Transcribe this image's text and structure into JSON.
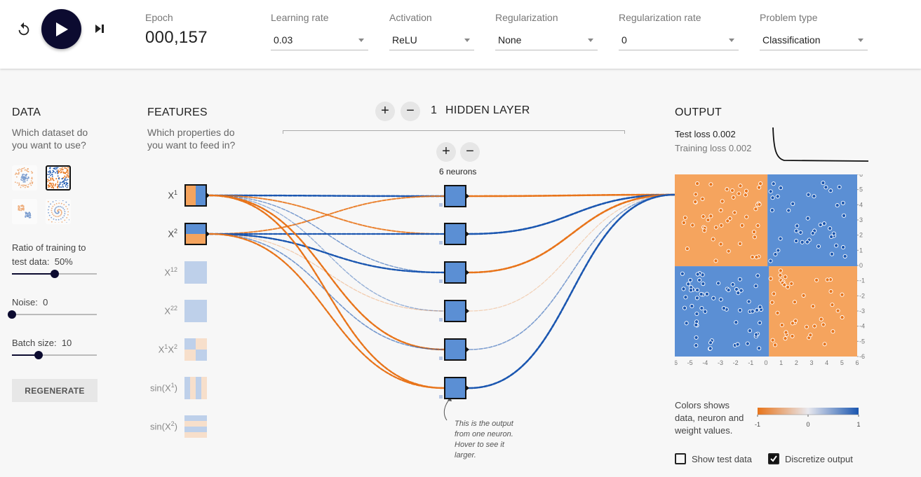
{
  "topbar": {
    "epoch_label": "Epoch",
    "epoch_value": "000,157",
    "learning_rate": {
      "label": "Learning rate",
      "value": "0.03"
    },
    "activation": {
      "label": "Activation",
      "value": "ReLU"
    },
    "regularization": {
      "label": "Regularization",
      "value": "None"
    },
    "regularization_rate": {
      "label": "Regularization rate",
      "value": "0"
    },
    "problem_type": {
      "label": "Problem type",
      "value": "Classification"
    }
  },
  "data_panel": {
    "title": "DATA",
    "subtitle_line1": "Which dataset do",
    "subtitle_line2": "you want to use?",
    "datasets": [
      "circle",
      "xor",
      "gaussian",
      "spiral"
    ],
    "selected_dataset": "xor",
    "ratio_label": "Ratio of training to",
    "ratio_label2": "test data:",
    "ratio_value": "50%",
    "ratio_fraction": 0.5,
    "noise_label": "Noise:",
    "noise_value": "0",
    "noise_fraction": 0,
    "batch_label": "Batch size:",
    "batch_value": "10",
    "batch_fraction": 0.31,
    "regenerate_label": "REGENERATE"
  },
  "features_panel": {
    "title": "FEATURES",
    "subtitle_line1": "Which properties do",
    "subtitle_line2": "you want to feed in?",
    "features": [
      {
        "base": "X",
        "sup": "1",
        "tail": "",
        "active": true
      },
      {
        "base": "X",
        "sup": "2",
        "tail": "",
        "active": true
      },
      {
        "base": "X",
        "sup": "12",
        "tail": "",
        "active": false
      },
      {
        "base": "X",
        "sup": "22",
        "tail": "",
        "active": false
      },
      {
        "base": "X",
        "sup": "1",
        "tail": "X2",
        "active": false
      },
      {
        "base": "sin(X",
        "sup": "1",
        "tail": ")",
        "active": false
      },
      {
        "base": "sin(X",
        "sup": "2",
        "tail": ")",
        "active": false
      }
    ]
  },
  "network": {
    "layer_count": "1",
    "layer_title": "HIDDEN LAYER",
    "neurons_label": "6 neurons",
    "annotation": [
      "This is the output",
      "from one neuron.",
      "Hover to see it",
      "larger."
    ]
  },
  "output_panel": {
    "title": "OUTPUT",
    "test_loss": "Test loss 0.002",
    "training_loss": "Training loss 0.002",
    "y_ticks": [
      "6",
      "5",
      "4",
      "3",
      "2",
      "1",
      "0",
      "-1",
      "-2",
      "-3",
      "-4",
      "-5",
      "-6"
    ],
    "x_ticks": [
      "-6",
      "-5",
      "-4",
      "-3",
      "-2",
      "-1",
      "0",
      "1",
      "2",
      "3",
      "4",
      "5",
      "6"
    ],
    "colors_text": [
      "Colors shows",
      "data, neuron and",
      "weight values."
    ],
    "colorbar_ticks": [
      "-1",
      "0",
      "1"
    ],
    "show_test_label": "Show test data",
    "show_test_checked": false,
    "discretize_label": "Discretize output",
    "discretize_checked": true
  },
  "colors": {
    "orange": "#f5a45e",
    "blue": "#5b8fd4",
    "dark_orange": "#e8741a",
    "dark_blue": "#1a56b0",
    "play": "#0c0b30"
  }
}
